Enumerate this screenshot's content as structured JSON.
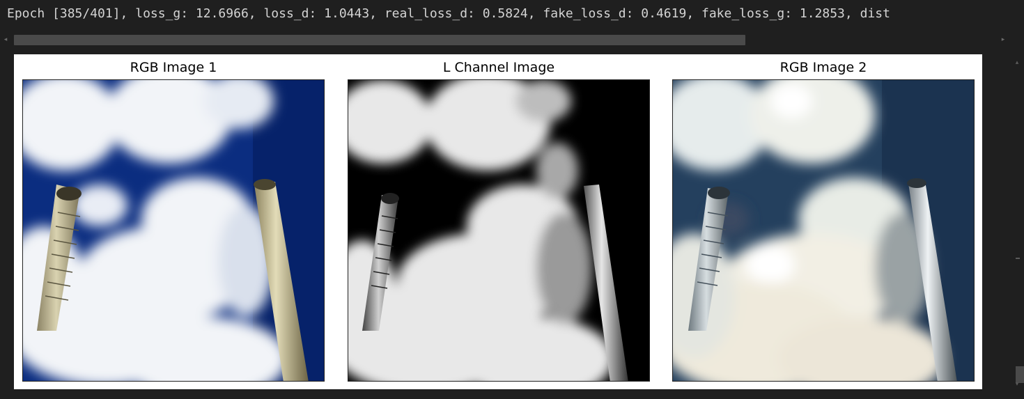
{
  "output": {
    "log_line": "Epoch [385/401], loss_g: 12.6966, loss_d: 1.0443, real_loss_d: 0.5824, fake_loss_d: 0.4619, fake_loss_g: 1.2853, dist"
  },
  "figure": {
    "panels": [
      {
        "title": "RGB Image 1"
      },
      {
        "title": "L Channel Image"
      },
      {
        "title": "RGB Image 2"
      }
    ]
  },
  "scrollbars": {
    "left_arrow": "◂",
    "right_arrow": "▸",
    "up_arrow": "▴",
    "down_arrow": "▾"
  },
  "colors": {
    "background": "#1f1f1f",
    "text": "#d4d4d4",
    "sky_rgb1": "#0a2a7a",
    "sky_rgb2": "#1e3e66"
  }
}
